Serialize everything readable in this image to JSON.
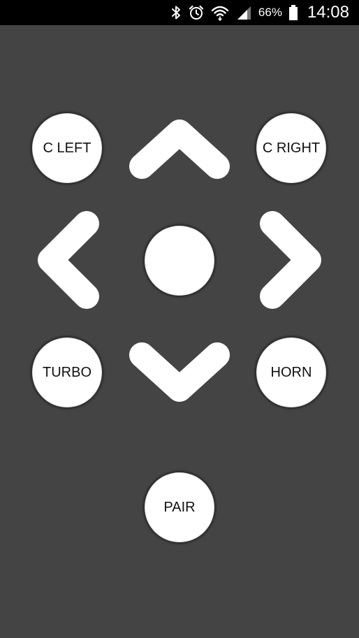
{
  "status_bar": {
    "battery_percent": "66%",
    "time": "14:08",
    "icons": [
      "bluetooth-icon",
      "alarm-icon",
      "wifi-icon",
      "cellular-signal-icon",
      "battery-icon"
    ]
  },
  "controls": {
    "c_left_label": "C LEFT",
    "c_right_label": "C RIGHT",
    "turbo_label": "TURBO",
    "horn_label": "HORN",
    "pair_label": "PAIR"
  },
  "colors": {
    "background": "#444444",
    "status_bar": "#000000",
    "button": "#ffffff",
    "button_text": "#111111"
  }
}
